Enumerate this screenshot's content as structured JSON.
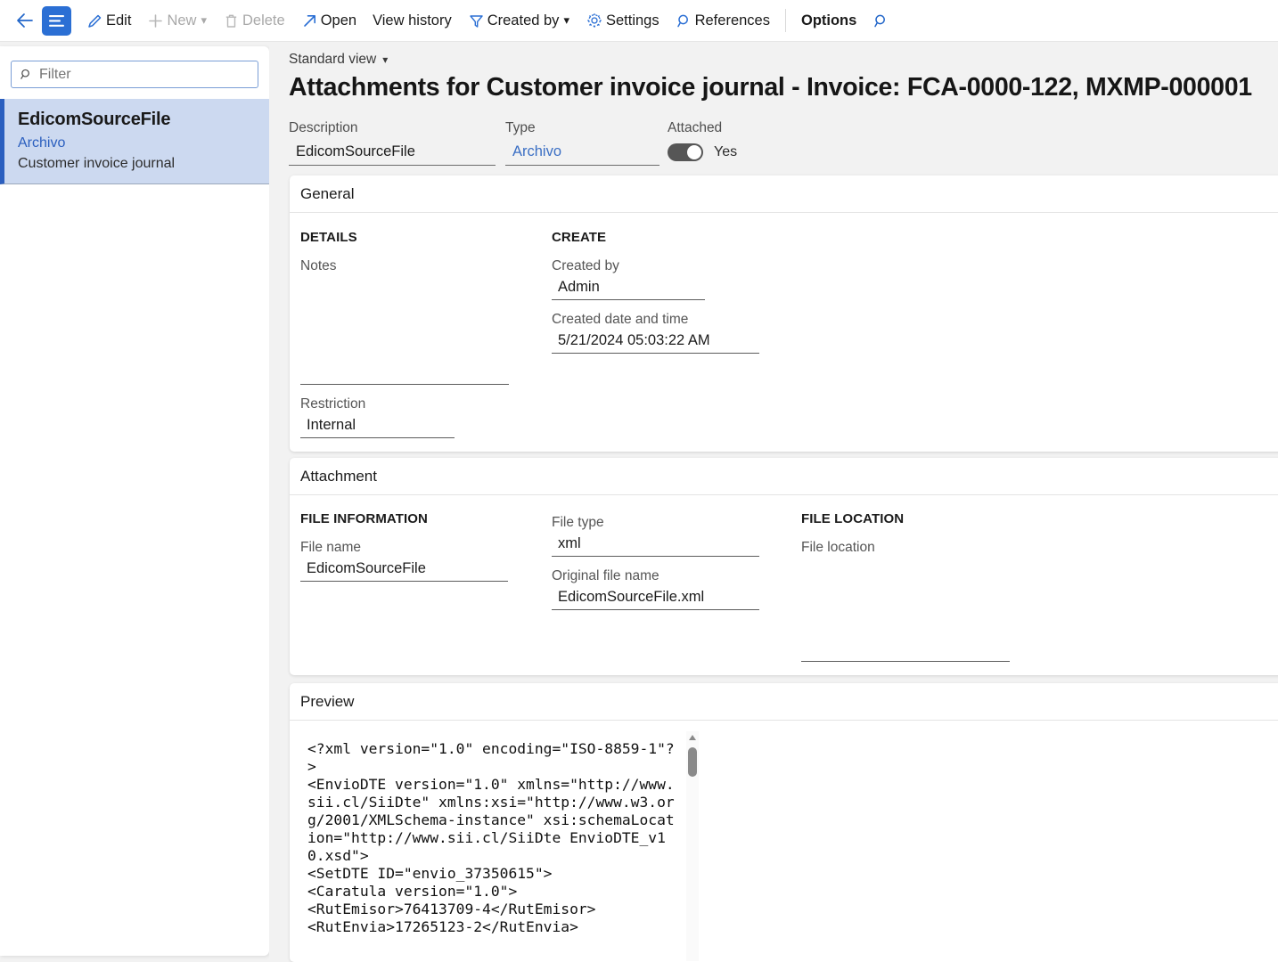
{
  "toolbar": {
    "back_label": "",
    "menu_label": "",
    "items": [
      {
        "label": "Edit",
        "icon": "pencil-icon",
        "disabled": false,
        "caret": false
      },
      {
        "label": "New",
        "icon": "plus-icon",
        "disabled": true,
        "caret": true
      },
      {
        "label": "Delete",
        "icon": "trash-icon",
        "disabled": true,
        "caret": false
      },
      {
        "label": "Open",
        "icon": "open-arrow-icon",
        "disabled": false,
        "caret": false
      },
      {
        "label": "View history",
        "icon": "none",
        "disabled": false,
        "caret": false
      },
      {
        "label": "Created by",
        "icon": "filter-icon",
        "disabled": false,
        "caret": true
      },
      {
        "label": "Settings",
        "icon": "gear-icon",
        "disabled": false,
        "caret": false
      },
      {
        "label": "References",
        "icon": "magnifier-icon",
        "disabled": false,
        "caret": false
      },
      {
        "label": "Options",
        "icon": "none",
        "disabled": false,
        "caret": false
      }
    ],
    "search_icon": "search-icon"
  },
  "sidebar": {
    "filter": {
      "placeholder": "Filter",
      "value": "",
      "icon": "search-icon"
    },
    "items": [
      {
        "title": "EdicomSourceFile",
        "subtitle": "Archivo",
        "caption": "Customer invoice journal",
        "selected": true
      }
    ]
  },
  "header": {
    "view_selector": "Standard view",
    "title": "Attachments for Customer invoice journal - Invoice: FCA-0000-122, MXMP-000001",
    "fields": {
      "description_label": "Description",
      "description_value": "EdicomSourceFile",
      "type_label": "Type",
      "type_value": "Archivo",
      "attached_label": "Attached",
      "attached_state": "Yes"
    }
  },
  "general": {
    "section_title": "General",
    "details_group": "DETAILS",
    "notes_label": "Notes",
    "notes_value": "",
    "restriction_label": "Restriction",
    "restriction_value": "Internal",
    "create_group": "CREATE",
    "created_by_label": "Created by",
    "created_by_value": "Admin",
    "created_date_label": "Created date and time",
    "created_date_value": "5/21/2024 05:03:22 AM"
  },
  "attachment": {
    "section_title": "Attachment",
    "file_info_group": "FILE INFORMATION",
    "file_name_label": "File name",
    "file_name_value": "EdicomSourceFile",
    "file_type_label": "File type",
    "file_type_value": "xml",
    "original_file_name_label": "Original file name",
    "original_file_name_value": "EdicomSourceFile.xml",
    "file_location_group": "FILE LOCATION",
    "file_location_label": "File location",
    "file_location_value": ""
  },
  "preview": {
    "section_title": "Preview",
    "content": "<?xml version=\"1.0\" encoding=\"ISO-8859-1\"?>\n<EnvioDTE version=\"1.0\" xmlns=\"http://www.sii.cl/SiiDte\" xmlns:xsi=\"http://www.w3.org/2001/XMLSchema-instance\" xsi:schemaLocation=\"http://www.sii.cl/SiiDte EnvioDTE_v10.xsd\">\n<SetDTE ID=\"envio_37350615\">\n<Caratula version=\"1.0\">\n<RutEmisor>76413709-4</RutEmisor>\n<RutEnvia>17265123-2</RutEnvia>",
    "scroll_up_icon": "scroll-up-arrow-icon"
  },
  "colors": {
    "accent": "#2b6fd4",
    "selection_bg": "#ccd9f0",
    "selection_border": "#2b5fbf",
    "link": "#3b6fc4",
    "page_bg": "#f2f2f2"
  }
}
